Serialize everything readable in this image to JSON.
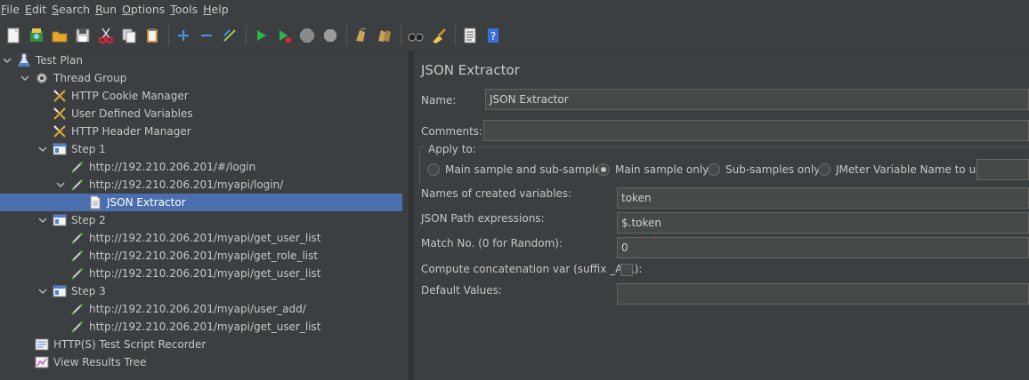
{
  "menu": [
    {
      "m": "F",
      "rest": "ile"
    },
    {
      "m": "E",
      "rest": "dit"
    },
    {
      "m": "S",
      "rest": "earch"
    },
    {
      "m": "R",
      "rest": "un"
    },
    {
      "m": "O",
      "rest": "ptions"
    },
    {
      "m": "T",
      "rest": "ools"
    },
    {
      "m": "H",
      "rest": "elp"
    }
  ],
  "toolbar": [
    "new-icon",
    "templates-icon",
    "open-icon",
    "save-icon",
    "cut-icon",
    "copy-icon",
    "paste-icon",
    "|",
    "expand-icon",
    "collapse-icon",
    "toggle-icon",
    "|",
    "start-icon",
    "start-no-pause-icon",
    "stop-icon",
    "shutdown-icon",
    "|",
    "clear-icon",
    "clear-all-icon",
    "|",
    "search-icon",
    "reset-search-icon",
    "|",
    "function-helper-icon",
    "help-icon"
  ],
  "tree": {
    "items": [
      {
        "label": "Test Plan",
        "depth": 0,
        "chev": "open",
        "icon": "testplan-icon"
      },
      {
        "label": "Thread Group",
        "depth": 1,
        "chev": "open",
        "icon": "gear-icon"
      },
      {
        "label": "HTTP Cookie Manager",
        "depth": 2,
        "chev": "none",
        "icon": "scissors-icon"
      },
      {
        "label": "User Defined Variables",
        "depth": 2,
        "chev": "none",
        "icon": "scissors-icon"
      },
      {
        "label": "HTTP Header Manager",
        "depth": 2,
        "chev": "none",
        "icon": "scissors-icon"
      },
      {
        "label": "Step 1",
        "depth": 2,
        "chev": "open",
        "icon": "controller-icon"
      },
      {
        "label": "http://192.210.206.201/#/login",
        "depth": 3,
        "chev": "none",
        "icon": "pipette-icon"
      },
      {
        "label": "http://192.210.206.201/myapi/login/",
        "depth": 3,
        "chev": "open",
        "icon": "pipette-icon"
      },
      {
        "label": "JSON Extractor",
        "depth": 4,
        "chev": "none",
        "icon": "document-icon",
        "selected": true
      },
      {
        "label": "Step 2",
        "depth": 2,
        "chev": "open",
        "icon": "controller-icon"
      },
      {
        "label": "http://192.210.206.201/myapi/get_user_list",
        "depth": 3,
        "chev": "none",
        "icon": "pipette-icon"
      },
      {
        "label": "http://192.210.206.201/myapi/get_role_list",
        "depth": 3,
        "chev": "none",
        "icon": "pipette-icon"
      },
      {
        "label": "http://192.210.206.201/myapi/get_user_list",
        "depth": 3,
        "chev": "none",
        "icon": "pipette-icon"
      },
      {
        "label": "Step 3",
        "depth": 2,
        "chev": "open",
        "icon": "controller-icon"
      },
      {
        "label": "http://192.210.206.201/myapi/user_add/",
        "depth": 3,
        "chev": "none",
        "icon": "pipette-icon"
      },
      {
        "label": "http://192.210.206.201/myapi/get_user_list",
        "depth": 3,
        "chev": "none",
        "icon": "pipette-icon"
      },
      {
        "label": "HTTP(S) Test Script Recorder",
        "depth": 1,
        "chev": "none",
        "icon": "recorder-icon"
      },
      {
        "label": "View Results Tree",
        "depth": 1,
        "chev": "none",
        "icon": "results-tree-icon"
      }
    ]
  },
  "panel": {
    "title": "JSON Extractor",
    "name_label": "Name:",
    "name_value": "JSON Extractor",
    "comments_label": "Comments:",
    "comments_value": "",
    "apply_to_label": "Apply to:",
    "apply_options": [
      {
        "label": "Main sample and sub-samples",
        "selected": false
      },
      {
        "label": "Main sample only",
        "selected": true
      },
      {
        "label": "Sub-samples only",
        "selected": false
      },
      {
        "label": "JMeter Variable Name to use",
        "selected": false
      }
    ],
    "jmeter_var_value": "",
    "var_names_label": "Names of created variables:",
    "var_names_value": "token",
    "json_path_label": "JSON Path expressions:",
    "json_path_value": "$.token",
    "match_no_label": "Match No. (0 for Random):",
    "match_no_value": "0",
    "concat_label": "Compute concatenation var (suffix _ALL):",
    "concat_checked": false,
    "default_label": "Default Values:",
    "default_value": ""
  },
  "colors": {
    "background": "#3c3f41",
    "selection": "#4b6eaf",
    "field": "#45494a",
    "annotation": "#e02020"
  }
}
